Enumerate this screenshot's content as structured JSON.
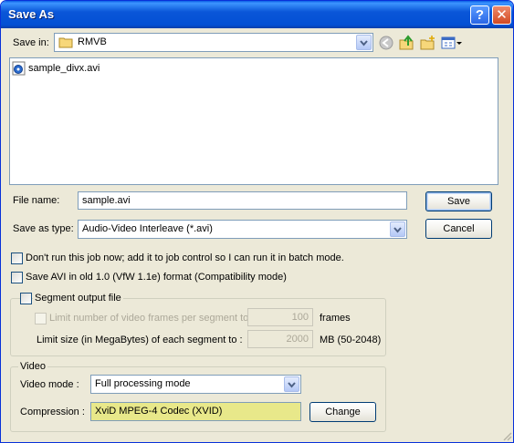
{
  "window": {
    "title": "Save As",
    "help_glyph": "?",
    "close_glyph": "✕"
  },
  "save_in": {
    "label": "Save in:",
    "value": "RMVB"
  },
  "toolbar": {
    "icons": [
      "back-icon",
      "up-folder-icon",
      "new-folder-icon",
      "view-menu-icon"
    ]
  },
  "files": [
    {
      "name": "sample_divx.avi",
      "icon": "avi-file-icon"
    }
  ],
  "file_name": {
    "label": "File name:",
    "value": "sample.avi"
  },
  "save_as_type": {
    "label": "Save as type:",
    "value": "Audio-Video Interleave (*.avi)"
  },
  "buttons": {
    "save": "Save",
    "cancel": "Cancel",
    "change": "Change"
  },
  "options": {
    "batch": "Don't run this job now; add it to job control so I can run it in batch mode.",
    "old_avi": "Save AVI in old 1.0 (VfW 1.1e) format (Compatibility mode)"
  },
  "segment": {
    "checkbox_label": "Segment output file",
    "limit_frames_label": "Limit number of video frames per segment to",
    "frames_value": "100",
    "frames_unit": "frames",
    "limit_size_label": "Limit size (in MegaBytes) of each segment to :",
    "size_value": "2000",
    "size_unit": "MB (50-2048)"
  },
  "video": {
    "group_title": "Video",
    "mode_label": "Video mode :",
    "mode_value": "Full processing mode",
    "compression_label": "Compression :",
    "compression_value": "XviD MPEG-4 Codec (XVID)"
  },
  "colors": {
    "titlebar": "#0a56d8",
    "dialog_bg": "#ece9d8",
    "compression_bg": "#e8e88a"
  }
}
